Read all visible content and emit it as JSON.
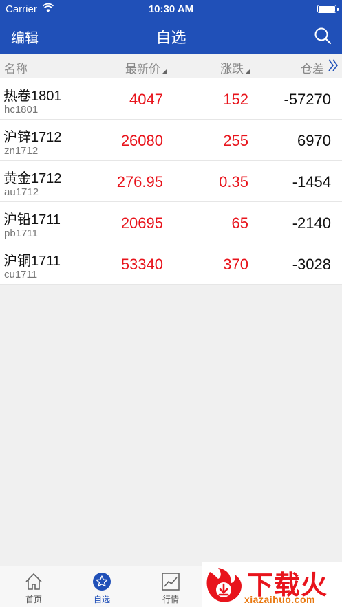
{
  "status_bar": {
    "carrier": "Carrier",
    "time": "10:30 AM"
  },
  "nav": {
    "edit": "编辑",
    "title": "自选"
  },
  "columns": {
    "name": "名称",
    "price": "最新价",
    "change": "涨跌",
    "open_interest": "仓差"
  },
  "rows": [
    {
      "name": "热卷1801",
      "code": "hc1801",
      "price": "4047",
      "change": "152",
      "open_interest": "-57270"
    },
    {
      "name": "沪锌1712",
      "code": "zn1712",
      "price": "26080",
      "change": "255",
      "open_interest": "6970"
    },
    {
      "name": "黄金1712",
      "code": "au1712",
      "price": "276.95",
      "change": "0.35",
      "open_interest": "-1454"
    },
    {
      "name": "沪铅1711",
      "code": "pb1711",
      "price": "20695",
      "change": "65",
      "open_interest": "-2140"
    },
    {
      "name": "沪铜1711",
      "code": "cu1711",
      "price": "53340",
      "change": "370",
      "open_interest": "-3028"
    }
  ],
  "tabs": [
    {
      "label": "首页",
      "icon": "home-icon"
    },
    {
      "label": "自选",
      "icon": "star-icon",
      "active": true
    },
    {
      "label": "行情",
      "icon": "chart-icon"
    }
  ],
  "watermark": {
    "text": "下载火",
    "sub": "xiazaihuo.com"
  },
  "colors": {
    "brand": "#2050b8",
    "up": "#e8141c",
    "watermark": "#e8141c"
  }
}
